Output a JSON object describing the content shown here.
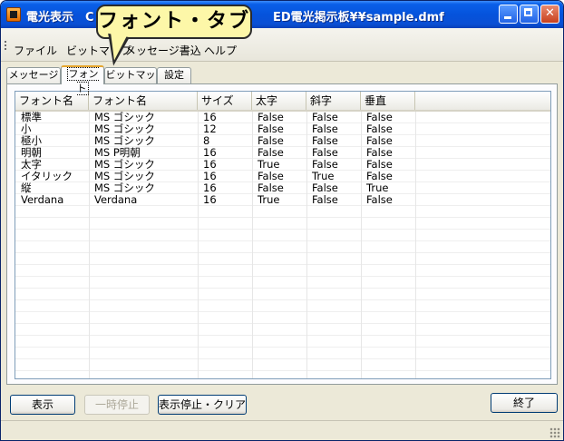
{
  "window": {
    "title_visible": "電光表示　C",
    "title_right": "ED電光掲示板¥¥sample.dmf"
  },
  "callout": {
    "text": "フォント・タブ"
  },
  "menu": {
    "items": [
      "ファイル",
      "ビットマップ",
      "メッセージ書込",
      "ヘルプ"
    ]
  },
  "tabs": [
    {
      "label": "メッセージ"
    },
    {
      "label": "フォント"
    },
    {
      "label": "ビットマップ"
    },
    {
      "label": "設定"
    }
  ],
  "table": {
    "columns": [
      "フォント名",
      "フォント名",
      "サイズ",
      "太字",
      "斜字",
      "垂直"
    ],
    "rows": [
      [
        "標準",
        "MS ゴシック",
        "16",
        "False",
        "False",
        "False"
      ],
      [
        "小",
        "MS ゴシック",
        "12",
        "False",
        "False",
        "False"
      ],
      [
        "極小",
        "MS ゴシック",
        "8",
        "False",
        "False",
        "False"
      ],
      [
        "明朝",
        "MS P明朝",
        "16",
        "False",
        "False",
        "False"
      ],
      [
        "太字",
        "MS ゴシック",
        "16",
        "True",
        "False",
        "False"
      ],
      [
        "イタリック",
        "MS ゴシック",
        "16",
        "False",
        "True",
        "False"
      ],
      [
        "縦",
        "MS ゴシック",
        "16",
        "False",
        "False",
        "True"
      ],
      [
        "Verdana",
        "Verdana",
        "16",
        "True",
        "False",
        "False"
      ]
    ]
  },
  "buttons": {
    "show": "表示",
    "pause": "一時停止",
    "stop_clear": "表示停止・クリア",
    "exit": "終了"
  }
}
